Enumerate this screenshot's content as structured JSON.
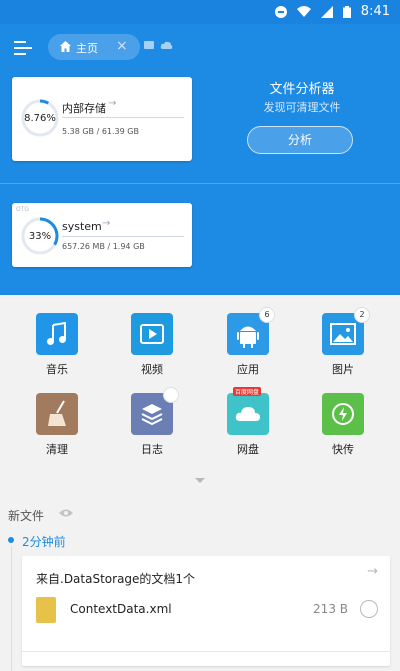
{
  "status_bar": {
    "time": "8:41"
  },
  "appbar": {
    "tab_label": "主页"
  },
  "analyzer": {
    "title": "文件分析器",
    "subtitle": "发现可清理文件",
    "button_label": "分析"
  },
  "storage_internal": {
    "name": "内部存储",
    "percent": "8.76%",
    "used": "5.38 GB / 61.39 GB"
  },
  "storage_otg": {
    "tag": "OTG",
    "name": "system",
    "percent": "33%",
    "used": "657.26 MB / 1.94 GB"
  },
  "apps": [
    {
      "label": "音乐",
      "icon": "music-icon",
      "color": "#2196e8"
    },
    {
      "label": "视频",
      "icon": "video-icon",
      "color": "#1e9be0"
    },
    {
      "label": "应用",
      "icon": "android-icon",
      "color": "#2c9ae6",
      "badge": "6"
    },
    {
      "label": "图片",
      "icon": "image-icon",
      "color": "#2799e4",
      "badge": "2"
    },
    {
      "label": "清理",
      "icon": "broom-icon",
      "color": "#a27a5e"
    },
    {
      "label": "日志",
      "icon": "log-icon",
      "color": "#6b7fb4"
    },
    {
      "label": "网盘",
      "icon": "cloud-icon",
      "color": "#3fc3c9",
      "tag": "百度网盘"
    },
    {
      "label": "快传",
      "icon": "transfer-icon",
      "color": "#5cbf4a"
    }
  ],
  "recent": {
    "section_title": "新文件",
    "group_label": "2分钟前",
    "card_title": "来自.DataStorage的文档1个",
    "file_name": "ContextData.xml",
    "file_size": "213 B"
  }
}
